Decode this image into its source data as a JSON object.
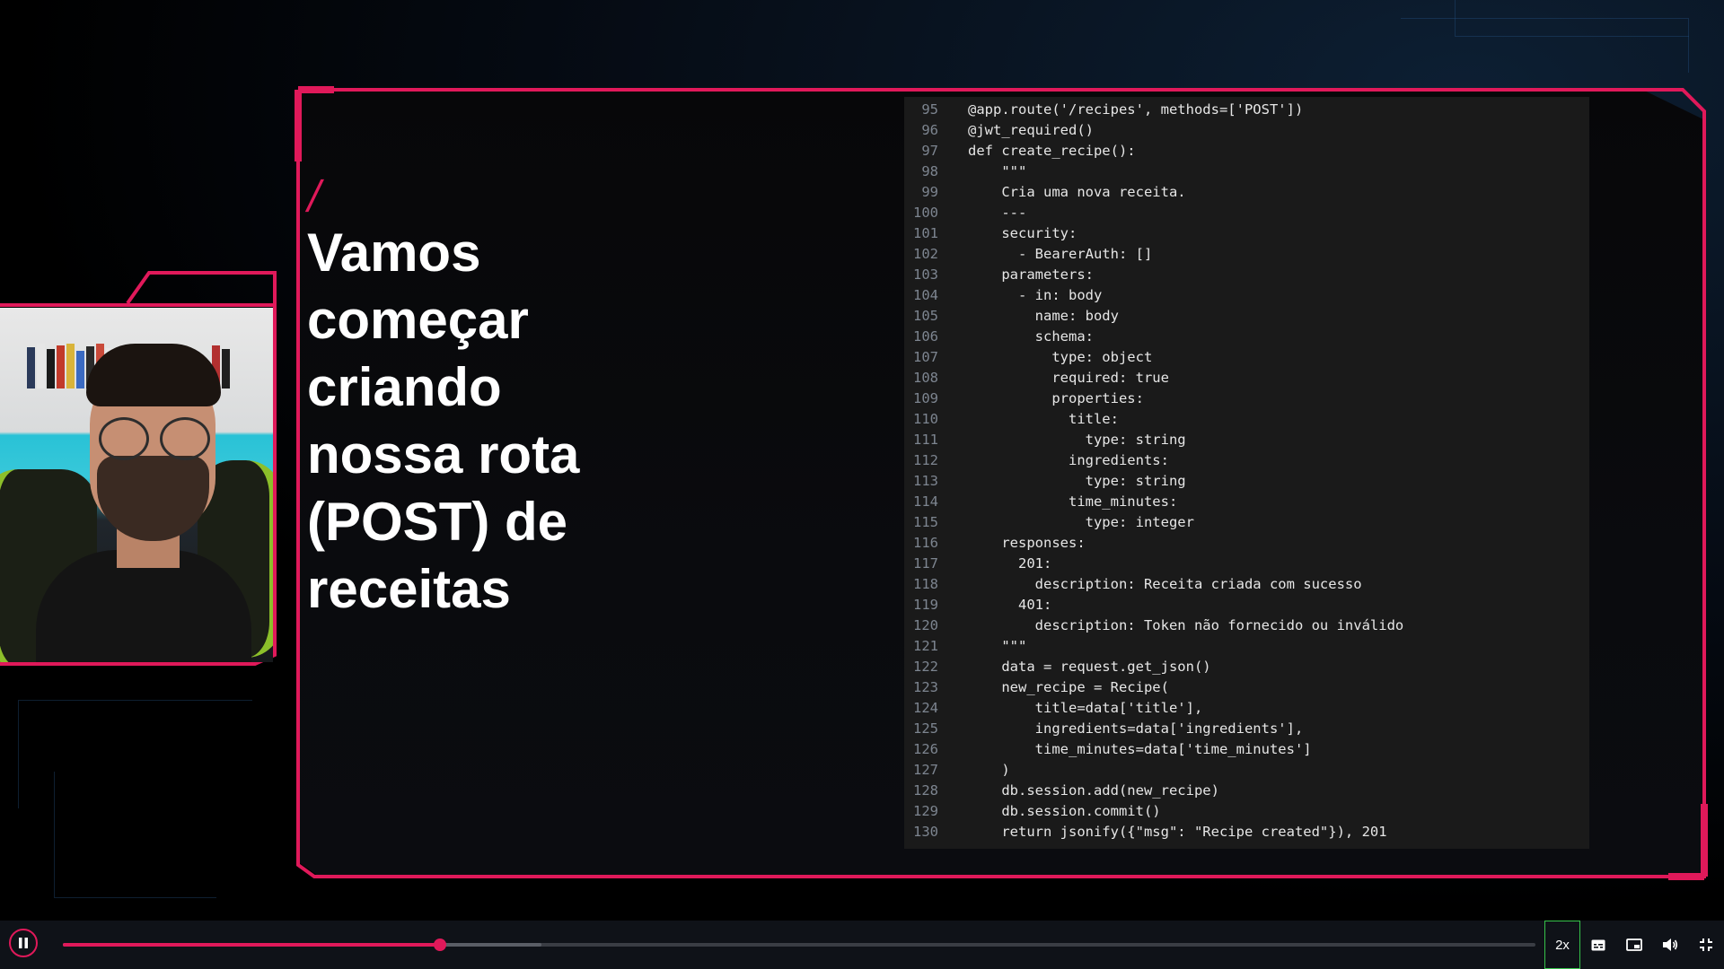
{
  "slide": {
    "accent": "/",
    "title_lines": [
      "Vamos",
      "começar",
      "criando",
      "nossa rota",
      "(POST) de",
      "receitas"
    ]
  },
  "code": {
    "lines": [
      {
        "n": "95",
        "t": "@app.route('/recipes', methods=['POST'])"
      },
      {
        "n": "96",
        "t": "@jwt_required()"
      },
      {
        "n": "97",
        "t": "def create_recipe():"
      },
      {
        "n": "98",
        "t": "    \"\"\""
      },
      {
        "n": "99",
        "t": "    Cria uma nova receita."
      },
      {
        "n": "100",
        "t": "    ---"
      },
      {
        "n": "101",
        "t": "    security:"
      },
      {
        "n": "102",
        "t": "      - BearerAuth: []"
      },
      {
        "n": "103",
        "t": "    parameters:"
      },
      {
        "n": "104",
        "t": "      - in: body"
      },
      {
        "n": "105",
        "t": "        name: body"
      },
      {
        "n": "106",
        "t": "        schema:"
      },
      {
        "n": "107",
        "t": "          type: object"
      },
      {
        "n": "108",
        "t": "          required: true"
      },
      {
        "n": "109",
        "t": "          properties:"
      },
      {
        "n": "110",
        "t": "            title:"
      },
      {
        "n": "111",
        "t": "              type: string"
      },
      {
        "n": "112",
        "t": "            ingredients:"
      },
      {
        "n": "113",
        "t": "              type: string"
      },
      {
        "n": "114",
        "t": "            time_minutes:"
      },
      {
        "n": "115",
        "t": "              type: integer"
      },
      {
        "n": "116",
        "t": "    responses:"
      },
      {
        "n": "117",
        "t": "      201:"
      },
      {
        "n": "118",
        "t": "        description: Receita criada com sucesso"
      },
      {
        "n": "119",
        "t": "      401:"
      },
      {
        "n": "120",
        "t": "        description: Token não fornecido ou inválido"
      },
      {
        "n": "121",
        "t": "    \"\"\""
      },
      {
        "n": "122",
        "t": "    data = request.get_json()"
      },
      {
        "n": "123",
        "t": "    new_recipe = Recipe("
      },
      {
        "n": "124",
        "t": "        title=data['title'],"
      },
      {
        "n": "125",
        "t": "        ingredients=data['ingredients'],"
      },
      {
        "n": "126",
        "t": "        time_minutes=data['time_minutes']"
      },
      {
        "n": "127",
        "t": "    )"
      },
      {
        "n": "128",
        "t": "    db.session.add(new_recipe)"
      },
      {
        "n": "129",
        "t": "    db.session.commit()"
      },
      {
        "n": "130",
        "t": "    return jsonify({\"msg\": \"Recipe created\"}), 201"
      }
    ]
  },
  "player": {
    "speed_label": "2x",
    "progress": 0.256,
    "buffered": 0.325,
    "icons": [
      "pause-icon",
      "captions-icon",
      "picture-in-picture-icon",
      "volume-icon",
      "exit-fullscreen-icon"
    ]
  },
  "colors": {
    "accent": "#e0195a",
    "speed_border": "#36c24a",
    "code_bg": "#1a1a1a"
  }
}
